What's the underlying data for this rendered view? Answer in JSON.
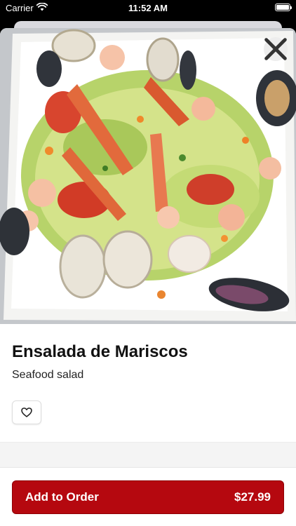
{
  "status_bar": {
    "carrier": "Carrier",
    "time": "11:52 AM"
  },
  "item": {
    "name": "Ensalada de Mariscos",
    "description": "Seafood salad",
    "image_icon": "seafood-salad-photo"
  },
  "actions": {
    "close_icon": "close-icon",
    "favorite_icon": "heart-icon",
    "add_label": "Add to Order",
    "price": "$27.99"
  },
  "colors": {
    "accent": "#b5080f",
    "background": "#ffffff"
  }
}
